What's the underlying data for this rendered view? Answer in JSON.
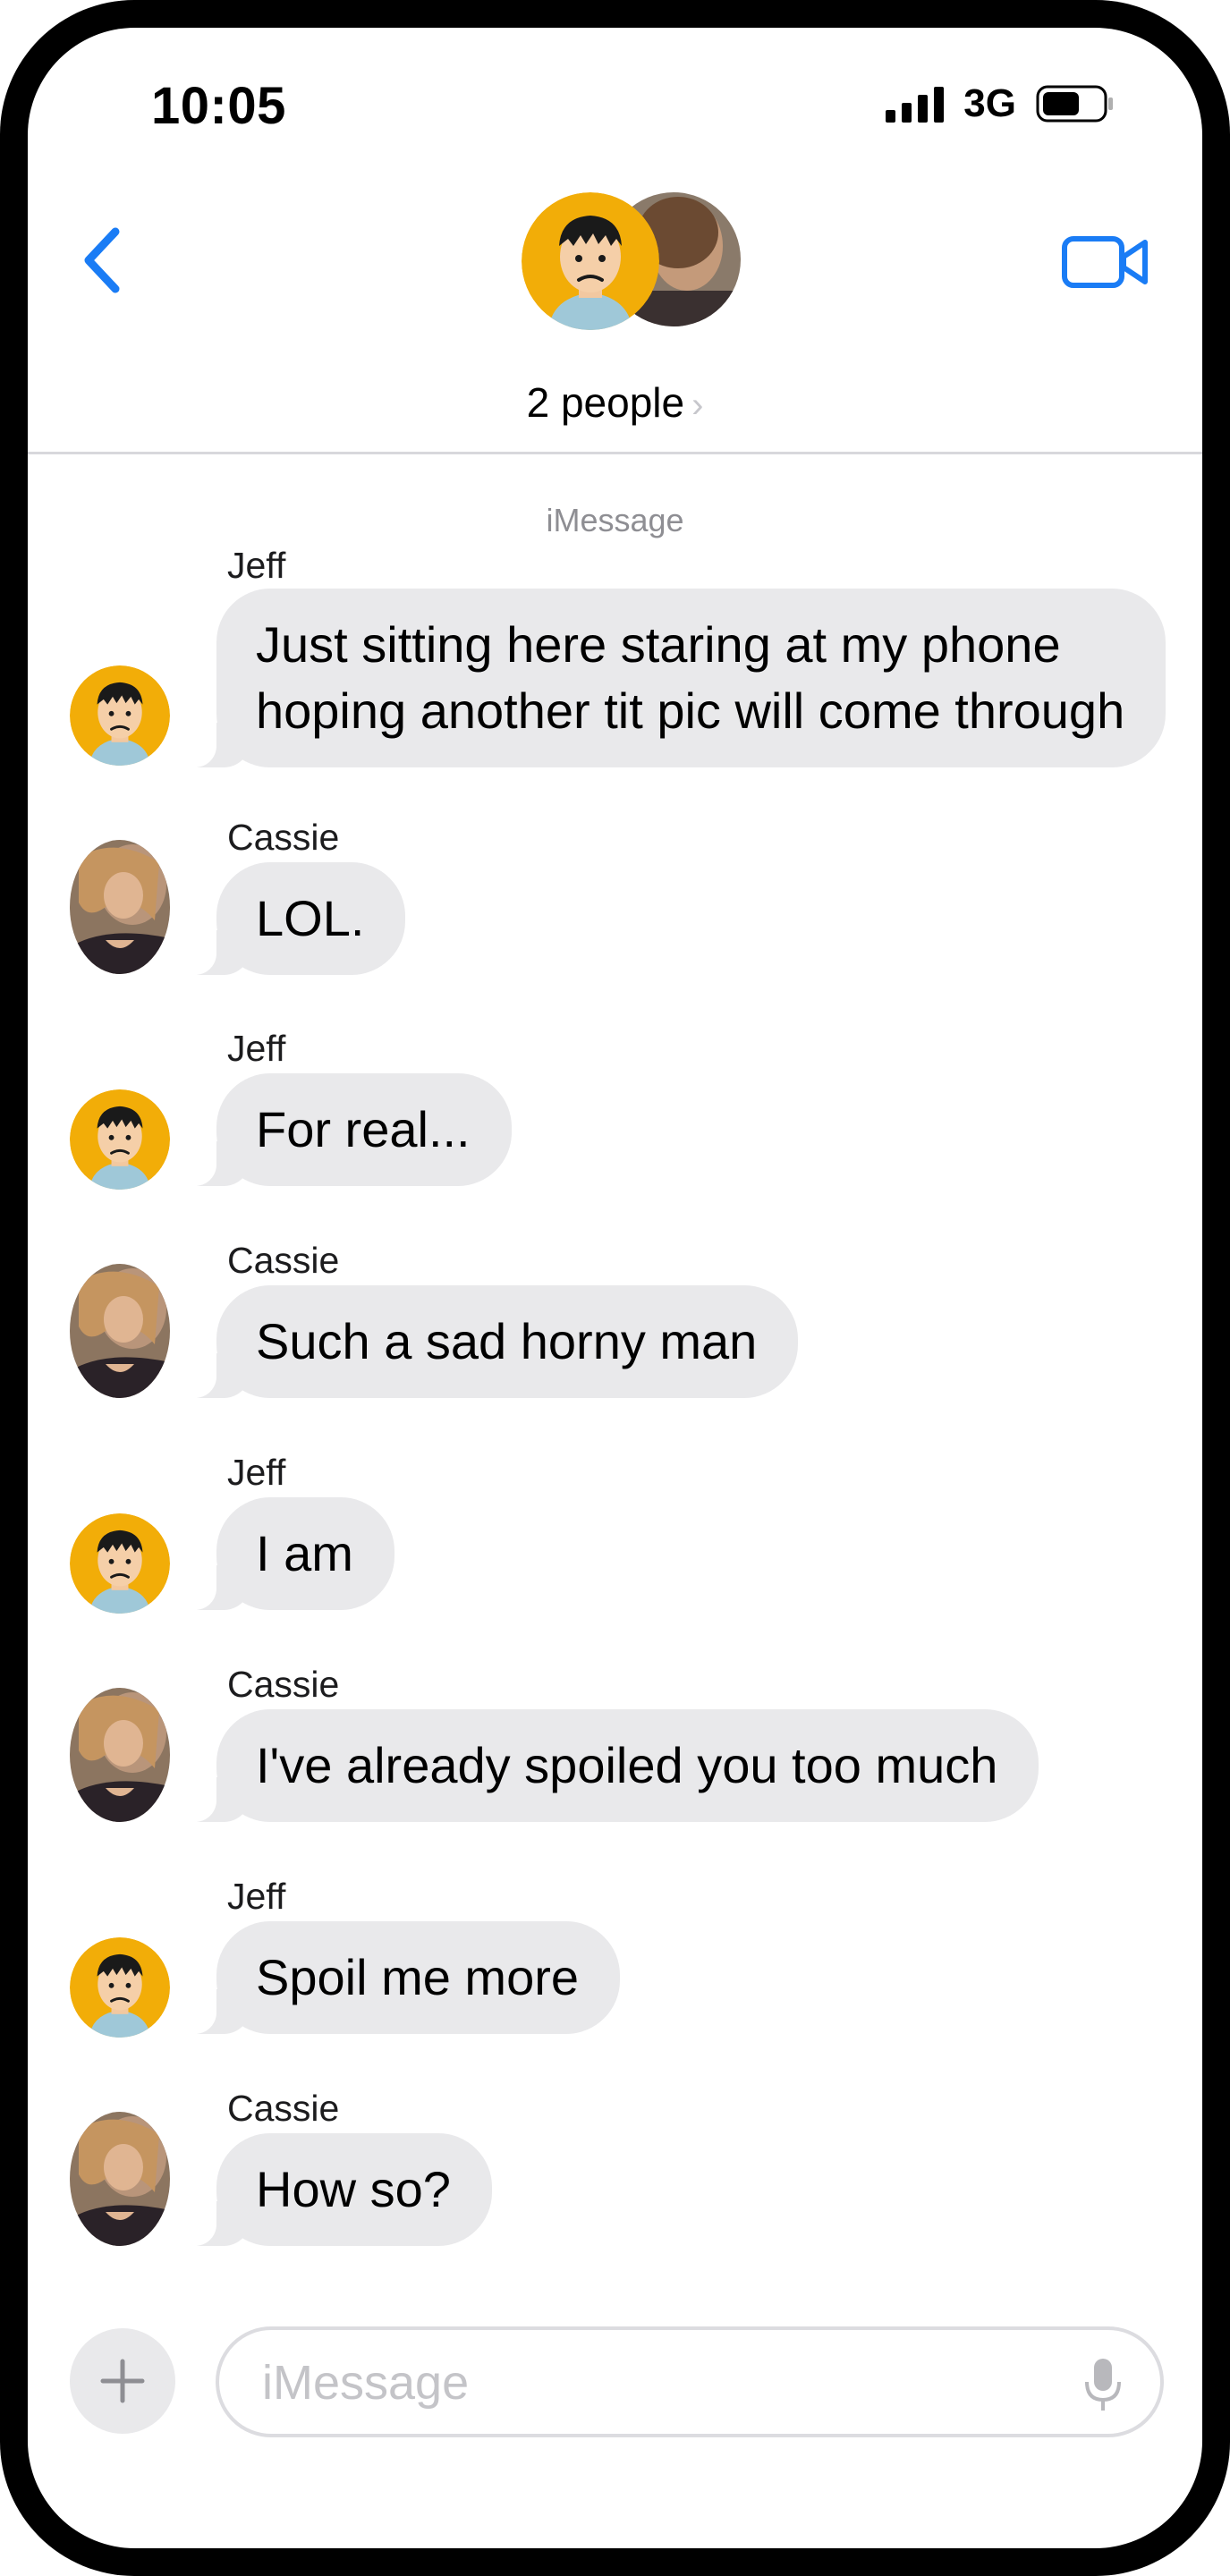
{
  "status_bar": {
    "time": "10:05",
    "network": "3G",
    "signal_bars": 4,
    "battery_level": 0.6
  },
  "header": {
    "title": "2 people",
    "chevron": "›",
    "back_icon": "chevron-left-icon",
    "video_icon": "video-camera-icon"
  },
  "conversation": {
    "service_label": "iMessage",
    "messages": [
      {
        "sender": "Jeff",
        "lines": [
          "Just sitting here staring at my phone",
          "hoping another tit pic will come through"
        ]
      },
      {
        "sender": "Cassie",
        "lines": [
          "LOL."
        ]
      },
      {
        "sender": "Jeff",
        "lines": [
          "For real..."
        ]
      },
      {
        "sender": "Cassie",
        "lines": [
          "Such a sad horny man"
        ]
      },
      {
        "sender": "Jeff",
        "lines": [
          "I am"
        ]
      },
      {
        "sender": "Cassie",
        "lines": [
          "I've already spoiled you too much"
        ]
      },
      {
        "sender": "Jeff",
        "lines": [
          "Spoil me more"
        ]
      },
      {
        "sender": "Cassie",
        "lines": [
          "How so?"
        ]
      }
    ]
  },
  "input_bar": {
    "placeholder": "iMessage",
    "plus_icon": "plus-icon",
    "mic_icon": "microphone-icon"
  },
  "colors": {
    "accent": "#1a7cf5",
    "bubble_gray": "#e9e9eb",
    "avatar_yellow": "#f2ad08"
  }
}
